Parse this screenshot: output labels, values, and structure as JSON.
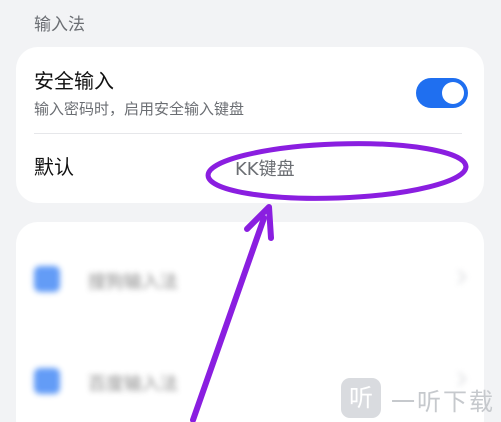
{
  "section": {
    "title": "输入法"
  },
  "secure_input": {
    "title": "安全输入",
    "subtitle": "输入密码时，启用安全输入键盘",
    "enabled": true
  },
  "default_keyboard": {
    "label": "默认",
    "value": "KK键盘"
  },
  "input_methods": [
    {
      "label": "搜狗输入法",
      "checked": true
    },
    {
      "label": "百度输入法",
      "checked": true
    }
  ],
  "watermark": {
    "icon_glyph": "听",
    "text": "一听下载"
  },
  "colors": {
    "accent": "#1f6ff0",
    "annotation": "#8a1ee0",
    "background": "#f2f3f5"
  }
}
